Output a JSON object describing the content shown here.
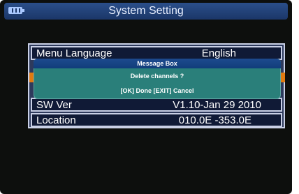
{
  "header": {
    "title": "System Setting",
    "battery_icon": "battery-icon"
  },
  "settings": {
    "rows": [
      {
        "label": "Menu Language",
        "value": "English"
      },
      {
        "label": "SW Ver",
        "value": "V1.10-Jan 29 2010"
      },
      {
        "label": "Location",
        "value": "010.0E -353.0E"
      }
    ]
  },
  "dialog": {
    "title": "Message Box",
    "message": "Delete channels ?",
    "hint": "[OK] Done [EXIT] Cancel"
  },
  "colors": {
    "screen_bg": "#0d0f0d",
    "title_bar": "#1b3668",
    "dialog_bg": "#2a7f7a",
    "accent_orange": "#e07a10"
  }
}
